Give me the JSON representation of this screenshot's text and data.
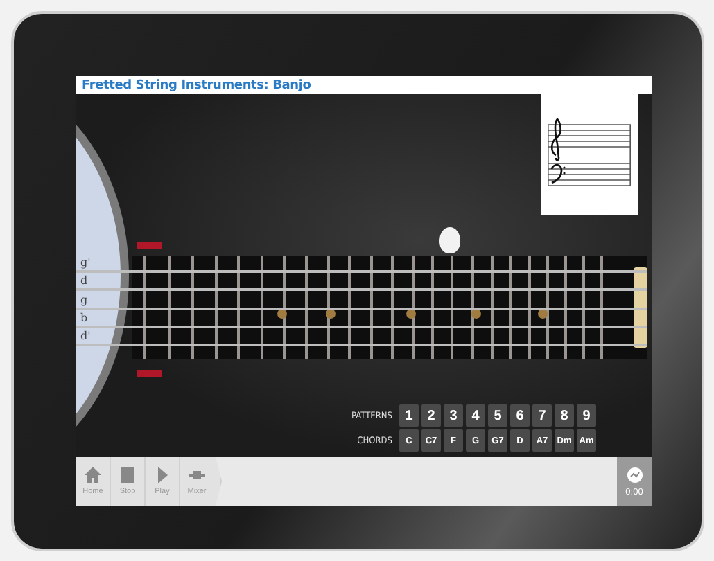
{
  "window": {
    "title": "Fretted String Instruments: Banjo"
  },
  "strings": [
    {
      "label": "g'"
    },
    {
      "label": "d"
    },
    {
      "label": "g"
    },
    {
      "label": "b"
    },
    {
      "label": "d'"
    }
  ],
  "patterns": {
    "label": "PATTERNS",
    "buttons": [
      "1",
      "2",
      "3",
      "4",
      "5",
      "6",
      "7",
      "8",
      "9"
    ]
  },
  "chords": {
    "label": "CHORDS",
    "buttons": [
      "C",
      "C7",
      "F",
      "G",
      "G7",
      "D",
      "A7",
      "Dm",
      "Am"
    ]
  },
  "toolbar": [
    {
      "kind": "home",
      "label": "Home"
    },
    {
      "kind": "stop",
      "label": "Stop"
    },
    {
      "kind": "play",
      "label": "Play"
    },
    {
      "kind": "mixer",
      "label": "Mixer"
    }
  ],
  "timer": "0:00"
}
